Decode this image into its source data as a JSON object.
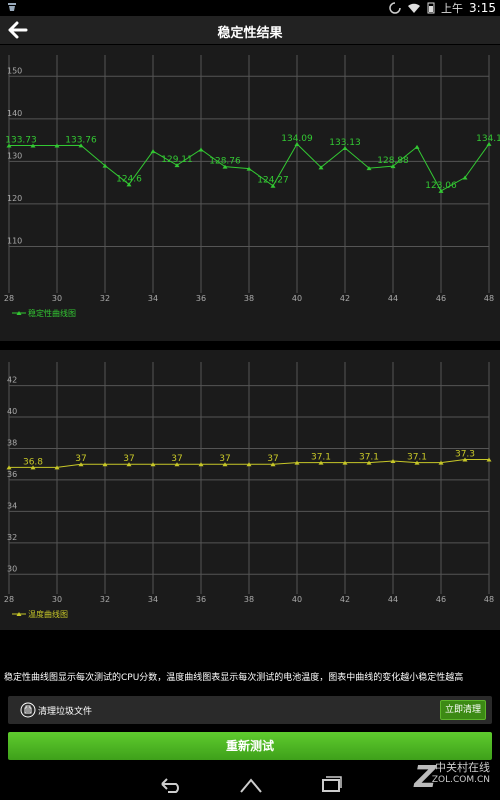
{
  "status_bar": {
    "time": "3:15",
    "ampm": "上午"
  },
  "header": {
    "title": "稳定性结果"
  },
  "chart_data": [
    {
      "type": "line",
      "x": [
        28,
        29,
        30,
        31,
        32,
        33,
        34,
        35,
        36,
        37,
        38,
        39,
        40,
        41,
        42,
        43,
        44,
        45,
        46,
        47,
        48
      ],
      "series": [
        {
          "name": "稳定性曲线图",
          "color": "#33c833",
          "values": [
            133.73,
            133.73,
            133.73,
            133.76,
            129.0,
            124.6,
            132.4,
            129.11,
            132.8,
            128.76,
            128.3,
            124.27,
            134.09,
            128.6,
            133.13,
            128.4,
            128.88,
            133.4,
            123.06,
            126.2,
            134.1
          ]
        }
      ],
      "point_labels": [
        {
          "x": 28.5,
          "v": 133.73
        },
        {
          "x": 31,
          "v": 133.76
        },
        {
          "x": 33,
          "v": 124.6
        },
        {
          "x": 35,
          "v": 129.11
        },
        {
          "x": 37,
          "v": 128.76
        },
        {
          "x": 39,
          "v": 124.27
        },
        {
          "x": 40,
          "v": 134.09
        },
        {
          "x": 42,
          "v": 133.13
        },
        {
          "x": 44,
          "v": 128.88
        },
        {
          "x": 46,
          "v": 123.06
        },
        {
          "x": 48,
          "v": 134.1
        }
      ],
      "xlim": [
        28,
        48
      ],
      "ylim": [
        100,
        155
      ],
      "x_ticks": [
        28,
        30,
        32,
        34,
        36,
        38,
        40,
        42,
        44,
        46,
        48
      ],
      "y_ticks": [
        110,
        120,
        130,
        140,
        150
      ],
      "legend": "bottom-left",
      "grid": true
    },
    {
      "type": "line",
      "x": [
        28,
        29,
        30,
        31,
        32,
        33,
        34,
        35,
        36,
        37,
        38,
        39,
        40,
        41,
        42,
        43,
        44,
        45,
        46,
        47,
        48
      ],
      "series": [
        {
          "name": "温度曲线图",
          "color": "#c8c828",
          "values": [
            36.8,
            36.8,
            36.8,
            37,
            37,
            37,
            37,
            37,
            37,
            37,
            37,
            37,
            37.1,
            37.1,
            37.1,
            37.1,
            37.2,
            37.1,
            37.1,
            37.3,
            37.3
          ]
        }
      ],
      "point_labels": [
        {
          "x": 29,
          "v": "36.8"
        },
        {
          "x": 31,
          "v": "37"
        },
        {
          "x": 33,
          "v": "37"
        },
        {
          "x": 35,
          "v": "37"
        },
        {
          "x": 37,
          "v": "37"
        },
        {
          "x": 39,
          "v": "37"
        },
        {
          "x": 41,
          "v": "37.1"
        },
        {
          "x": 43,
          "v": "37.1"
        },
        {
          "x": 45,
          "v": "37.1"
        },
        {
          "x": 47,
          "v": "37.3"
        }
      ],
      "xlim": [
        28,
        48
      ],
      "ylim": [
        29,
        43.5
      ],
      "x_ticks": [
        28,
        30,
        32,
        34,
        36,
        38,
        40,
        42,
        44,
        46,
        48
      ],
      "y_ticks": [
        30,
        32,
        34,
        36,
        38,
        40,
        42
      ],
      "legend": "bottom-left",
      "grid": true
    }
  ],
  "info_text": "稳定性曲线图显示每次测试的CPU分数，温度曲线图表显示每次测试的电池温度，图表中曲线的变化越小稳定性越高",
  "clean": {
    "label": "清理垃圾文件",
    "button": "立即清理"
  },
  "retest_button": "重新测试",
  "watermark": {
    "line1": "中关村在线",
    "line2": "ZOL.COM.CN"
  }
}
